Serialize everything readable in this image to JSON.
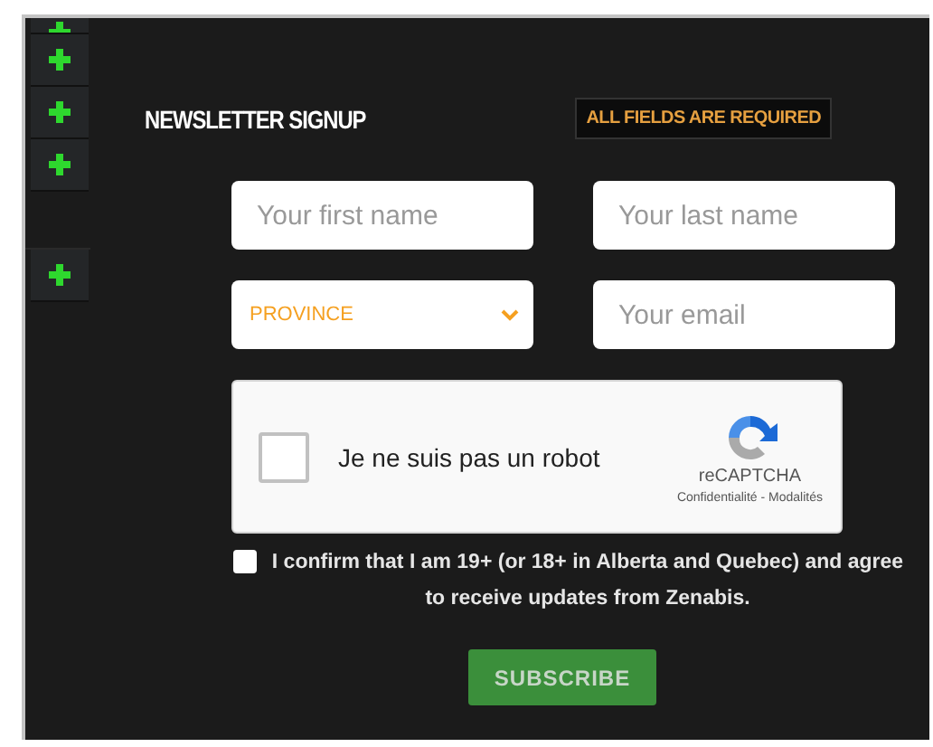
{
  "form": {
    "title": "NEWSLETTER SIGNUP",
    "required_note": "ALL FIELDS ARE REQUIRED",
    "fields": [
      {
        "kind": "text",
        "placeholder": "Your first name"
      },
      {
        "kind": "text",
        "placeholder": "Your last name"
      },
      {
        "kind": "select",
        "placeholder": "PROVINCE"
      },
      {
        "kind": "text",
        "placeholder": "Your email"
      }
    ],
    "captcha": {
      "label": "Je ne suis pas un robot",
      "checked": false,
      "brand": "reCAPTCHA",
      "links": "Confidentialité - Modalités"
    },
    "consent": {
      "checked": false,
      "text": "I confirm that I am 19+ (or 18+ in Alberta and Quebec) and agree to receive updates from Zenabis."
    },
    "submit": "SUBSCRIBE"
  }
}
